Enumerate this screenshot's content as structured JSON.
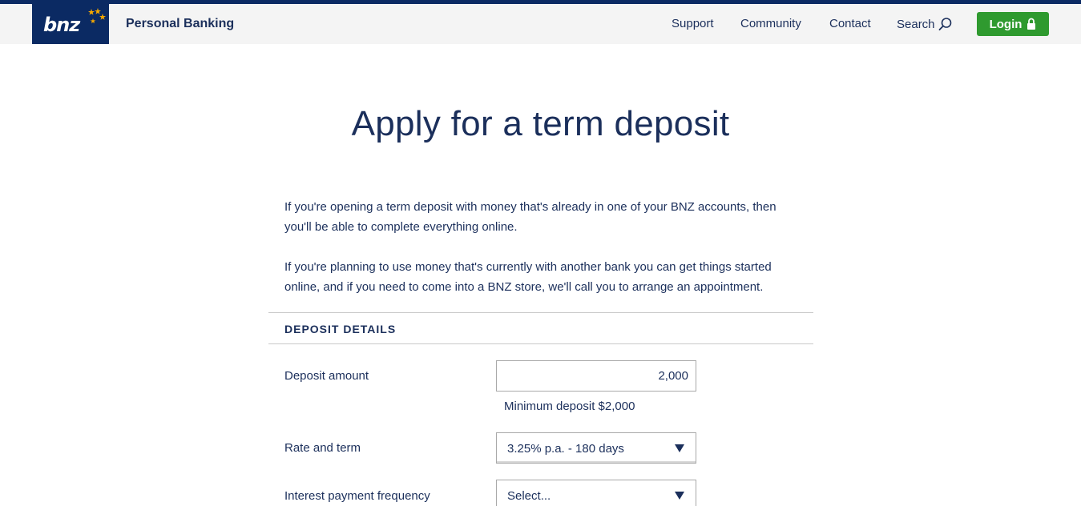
{
  "header": {
    "brand_logo_text": "bnz",
    "title": "Personal Banking",
    "nav": {
      "support": "Support",
      "community": "Community",
      "contact": "Contact",
      "search": "Search"
    },
    "login_label": "Login",
    "icons": [
      "star-icon",
      "search-icon",
      "lock-icon"
    ]
  },
  "page": {
    "title": "Apply for a term deposit",
    "intro_1": "If you're opening a term deposit with money that's already in one of your BNZ accounts, then you'll be able to complete everything online.",
    "intro_2": "If you're planning to use money that's currently with another bank you can get things started online, and if you need to come into a BNZ store, we'll call you to arrange an appointment."
  },
  "deposit_details": {
    "heading": "DEPOSIT DETAILS",
    "amount_label": "Deposit amount",
    "amount_value": "2,000",
    "amount_hint": "Minimum deposit $2,000",
    "rate_label": "Rate and term",
    "rate_value": "3.25% p.a. - 180 days",
    "frequency_label": "Interest payment frequency",
    "frequency_value": "Select..."
  },
  "colors": {
    "brand_navy": "#0b2a63",
    "text": "#1b2f5b",
    "login_green": "#2f9a2f",
    "star_gold": "#f5a800"
  }
}
